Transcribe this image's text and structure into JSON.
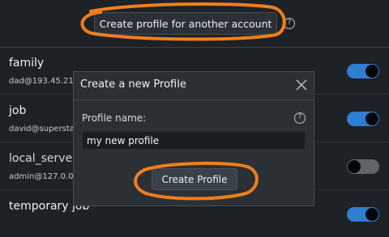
{
  "header": {
    "button_label": "Create profile for another account",
    "help_glyph": "?"
  },
  "profiles": [
    {
      "name": "family",
      "account": "dad@193.45.21",
      "enabled": true
    },
    {
      "name": "job",
      "account": "david@supersta",
      "enabled": true
    },
    {
      "name": "local_server",
      "account": "admin@127.0.0",
      "enabled": false
    },
    {
      "name": "temporary job",
      "account": "",
      "enabled": true
    }
  ],
  "dialog": {
    "title": "Create a new Profile",
    "field_label": "Profile name:",
    "field_value": "my new profile",
    "help_glyph": "?",
    "create_button_label": "Create Profile"
  },
  "colors": {
    "background": "#1e2125",
    "dialog_background": "#2b3035",
    "accent_toggle_on": "#2f7ecf",
    "annotation_orange": "#f07f1a"
  },
  "icons": [
    "help-icon",
    "close-icon"
  ]
}
